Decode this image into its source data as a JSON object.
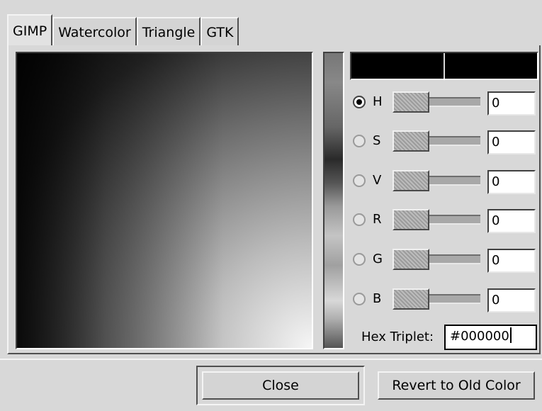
{
  "tabs": [
    {
      "label": "GIMP",
      "active": true
    },
    {
      "label": "Watercolor",
      "active": false
    },
    {
      "label": "Triangle",
      "active": false
    },
    {
      "label": "GTK",
      "active": false
    }
  ],
  "swatch": {
    "new_color": "#000000",
    "old_color": "#000000"
  },
  "channels": [
    {
      "label": "H",
      "value": "0",
      "selected": true
    },
    {
      "label": "S",
      "value": "0",
      "selected": false
    },
    {
      "label": "V",
      "value": "0",
      "selected": false
    },
    {
      "label": "R",
      "value": "0",
      "selected": false
    },
    {
      "label": "G",
      "value": "0",
      "selected": false
    },
    {
      "label": "B",
      "value": "0",
      "selected": false
    }
  ],
  "hex": {
    "label": "Hex Triplet:",
    "value": "#000000"
  },
  "buttons": {
    "close": "Close",
    "revert": "Revert to Old Color"
  }
}
